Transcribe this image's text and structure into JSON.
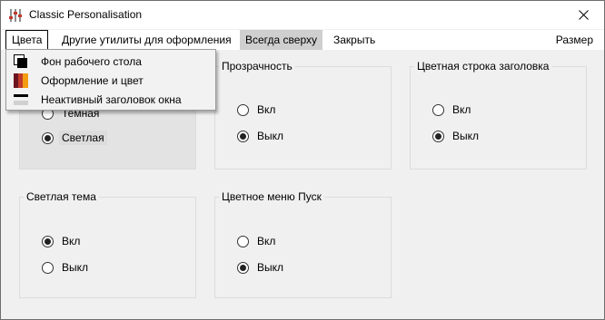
{
  "window": {
    "title": "Classic Personalisation"
  },
  "menu": {
    "colors": "Цвета",
    "other_utils": "Другие утилиты для оформления",
    "always_on_top": "Всегда сверху",
    "close": "Закрыть",
    "size": "Размер"
  },
  "dropdown": {
    "items": [
      {
        "label": "Фон рабочего стола",
        "icon": "desktop-background-icon"
      },
      {
        "label": "Оформление и цвет",
        "icon": "color-palette-icon"
      },
      {
        "label": "Неактивный заголовок окна",
        "icon": "inactive-titlebar-icon"
      }
    ]
  },
  "groups": {
    "theme": {
      "options": [
        {
          "label": "Темная",
          "checked": false
        },
        {
          "label": "Светлая",
          "checked": true
        }
      ]
    },
    "transparency": {
      "title": "Прозрачность",
      "options": [
        {
          "label": "Вкл",
          "checked": false
        },
        {
          "label": "Выкл",
          "checked": true
        }
      ]
    },
    "color_titlebar": {
      "title": "Цветная строка заголовка",
      "options": [
        {
          "label": "Вкл",
          "checked": false
        },
        {
          "label": "Выкл",
          "checked": true
        }
      ]
    },
    "light_theme": {
      "title": "Светлая тема",
      "options": [
        {
          "label": "Вкл",
          "checked": true
        },
        {
          "label": "Выкл",
          "checked": false
        }
      ]
    },
    "color_start": {
      "title": "Цветное меню Пуск",
      "options": [
        {
          "label": "Вкл",
          "checked": false
        },
        {
          "label": "Выкл",
          "checked": true
        }
      ]
    }
  },
  "colors": {
    "menu_highlight": "#cfcfcf",
    "panel_shade": "#e3e3e3"
  }
}
